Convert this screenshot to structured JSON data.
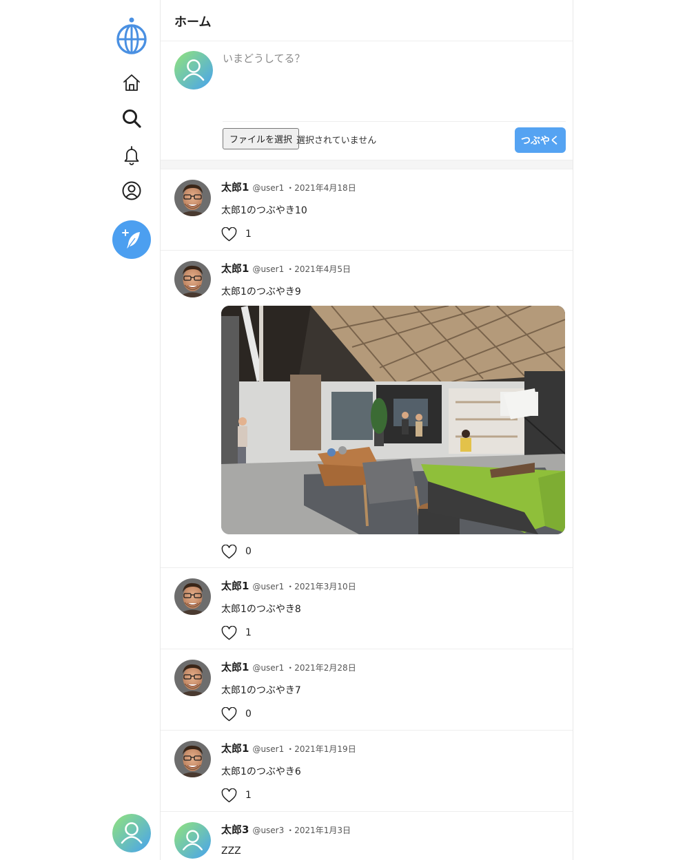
{
  "sidebar": {
    "logo_icon": "globe-logo-icon",
    "items": [
      {
        "name": "home",
        "icon": "home-icon"
      },
      {
        "name": "search",
        "icon": "search-icon"
      },
      {
        "name": "notifications",
        "icon": "bell-icon"
      },
      {
        "name": "profile",
        "icon": "user-circle-icon"
      }
    ],
    "compose_icon": "feather-plus-icon",
    "account_avatar": "default-avatar"
  },
  "header": {
    "title": "ホーム"
  },
  "composer": {
    "placeholder": "いまどうしてる？",
    "file_button_label": "ファイルを選択",
    "file_status": "選択されていません",
    "submit_label": "つぶやく"
  },
  "colors": {
    "accent": "#4c9ff0",
    "avatar_gradient_start": "#8ee57e",
    "avatar_gradient_end": "#4aa4ee"
  },
  "posts": [
    {
      "name": "太郎1",
      "handle": "@user1",
      "date": "・2021年4月18日",
      "text": "太郎1のつぶやき10",
      "likes": "1",
      "has_image": false
    },
    {
      "name": "太郎1",
      "handle": "@user1",
      "date": "・2021年4月5日",
      "text": "太郎1のつぶやき9",
      "likes": "0",
      "has_image": true
    },
    {
      "name": "太郎1",
      "handle": "@user1",
      "date": "・2021年3月10日",
      "text": "太郎1のつぶやき8",
      "likes": "1",
      "has_image": false
    },
    {
      "name": "太郎1",
      "handle": "@user1",
      "date": "・2021年2月28日",
      "text": "太郎1のつぶやき7",
      "likes": "0",
      "has_image": false
    },
    {
      "name": "太郎1",
      "handle": "@user1",
      "date": "・2021年1月19日",
      "text": "太郎1のつぶやき6",
      "likes": "1",
      "has_image": false
    },
    {
      "name": "太郎3",
      "handle": "@user3",
      "date": "・2021年1月3日",
      "text": "ZZZ",
      "likes": "",
      "has_image": false
    }
  ]
}
